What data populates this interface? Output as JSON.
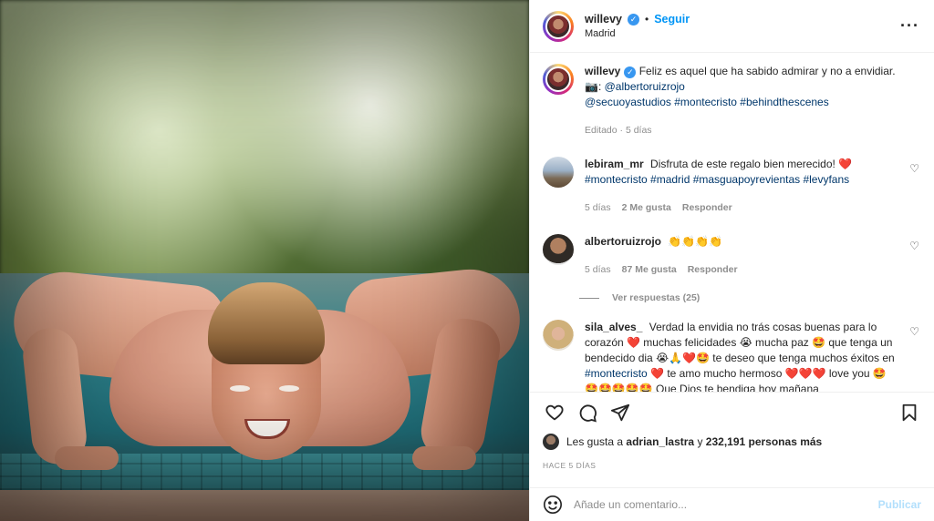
{
  "post": {
    "username": "willevy",
    "follow_label": "Seguir",
    "location": "Madrid",
    "more_icon": "more-options-icon"
  },
  "caption": {
    "username": "willevy",
    "text": "Feliz es aquel que ha sabido admirar y no a envidiar.",
    "camera_emoji": "📷",
    "mention_1": "@albertoruizrojo",
    "mention_2": "@secuoyastudios",
    "tag_1": "#montecristo",
    "tag_2": "#behindthescenes",
    "meta": "Editado · 5 días"
  },
  "comments": [
    {
      "username": "lebiram_mr",
      "text": "Disfruta de este regalo bien merecido! ❤️",
      "tags": "#montecristo #madrid #masguapoyrevientas #levyfans",
      "time": "5 días",
      "likes": "2 Me gusta",
      "reply": "Responder"
    },
    {
      "username": "albertoruizrojo",
      "text": "👏👏👏👏",
      "time": "5 días",
      "likes": "87 Me gusta",
      "reply": "Responder",
      "view_replies": "Ver respuestas (25)"
    },
    {
      "username": "sila_alves_",
      "text_1": "Verdad la envidia no trás cosas buenas para lo corazón ❤️ muchas felicidades 😭 mucha paz 🤩 que tenga un bendecido dia 😭🙏❤️🤩 te deseo que tenga muchos éxitos en ",
      "tag": "#montecristo",
      "text_2": " ❤️ te amo mucho hermoso ❤️❤️❤️ love you 🤩🤩🤩🤩🤩🤩 Que Dios te bendiga hoy mañana"
    }
  ],
  "likes": {
    "prefix": "Les gusta a",
    "user": "adrian_lastra",
    "conj": "y",
    "count": "232,191 personas más"
  },
  "time_ago": "HACE 5 DÍAS",
  "add_comment": {
    "placeholder": "Añade un comentario...",
    "post_label": "Publicar"
  },
  "colors": {
    "link": "#00376b",
    "follow": "#0095f6",
    "post_disabled": "#b2dffc",
    "muted": "#8e8e8e"
  }
}
